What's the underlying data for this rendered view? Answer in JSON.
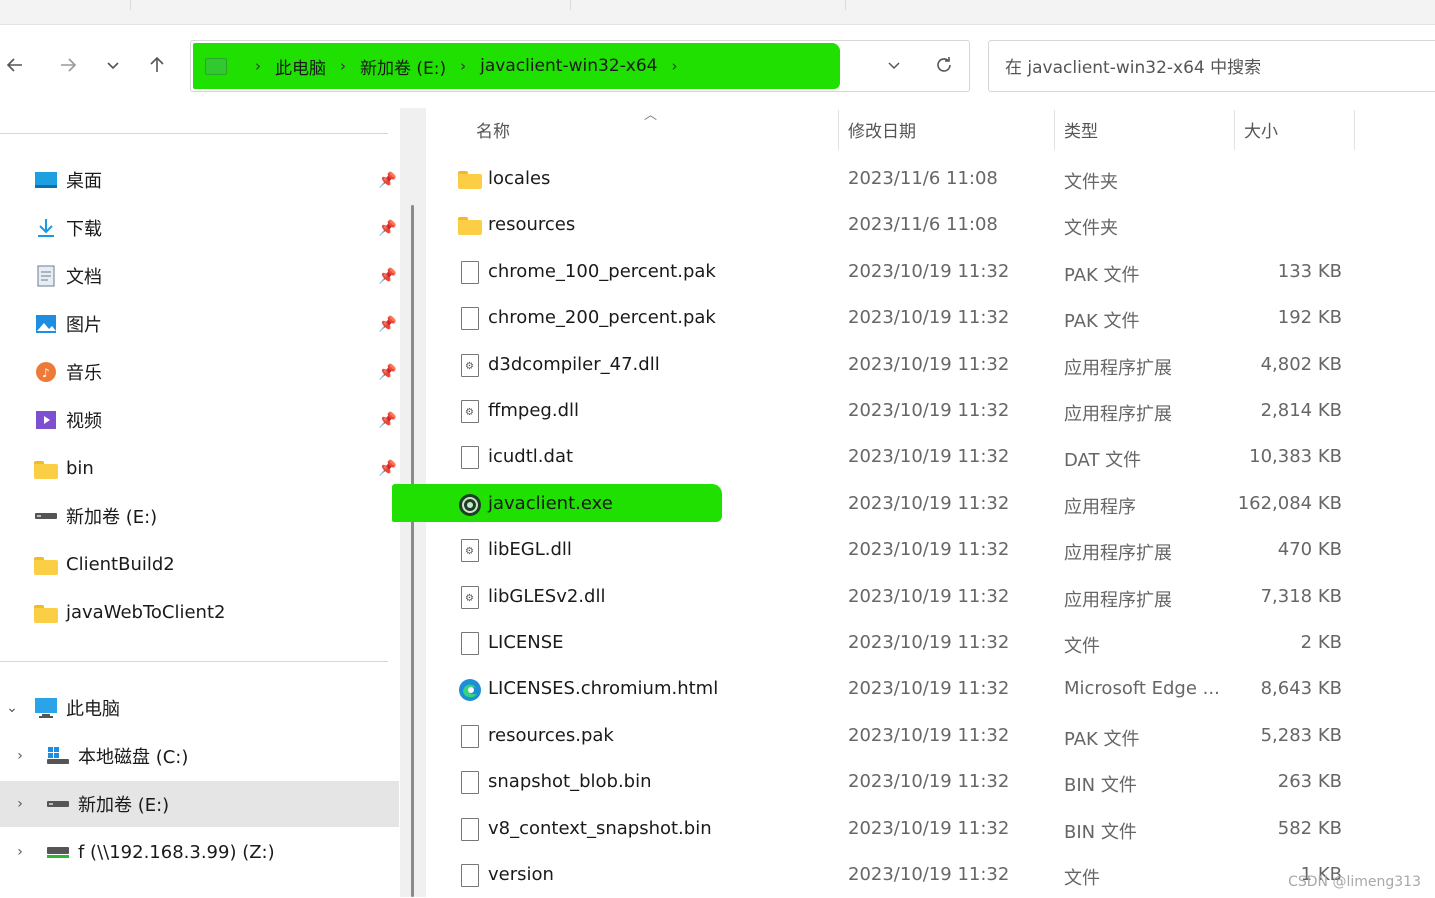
{
  "toolbar": {
    "back_icon": "arrow-left-icon",
    "forward_icon": "arrow-right-icon",
    "recent_icon": "chevron-down-icon",
    "up_icon": "arrow-up-icon"
  },
  "address": {
    "crumbs": [
      "此电脑",
      "新加卷 (E:)",
      "javaclient-win32-x64"
    ],
    "highlight_color": "#1fe000"
  },
  "search": {
    "placeholder": "在 javaclient-win32-x64 中搜索"
  },
  "navpane": {
    "quick_access": [
      {
        "label": "桌面",
        "icon": "desktop-icon"
      },
      {
        "label": "下载",
        "icon": "download-icon"
      },
      {
        "label": "文档",
        "icon": "documents-icon"
      },
      {
        "label": "图片",
        "icon": "pictures-icon"
      },
      {
        "label": "音乐",
        "icon": "music-icon"
      },
      {
        "label": "视频",
        "icon": "videos-icon"
      },
      {
        "label": "bin",
        "icon": "folder-icon"
      },
      {
        "label": "新加卷 (E:)",
        "icon": "drive-icon"
      },
      {
        "label": "ClientBuild2",
        "icon": "folder-icon"
      },
      {
        "label": "javaWebToClient2",
        "icon": "folder-icon"
      }
    ],
    "this_pc": "此电脑",
    "drives": [
      {
        "label": "本地磁盘 (C:)",
        "icon": "system-drive-icon"
      },
      {
        "label": "新加卷 (E:)",
        "icon": "drive-icon",
        "selected": true
      },
      {
        "label": "f (\\\\192.168.3.99) (Z:)",
        "icon": "network-drive-icon"
      }
    ]
  },
  "columns": {
    "name": "名称",
    "modified": "修改日期",
    "type": "类型",
    "size": "大小"
  },
  "files": [
    {
      "name": "locales",
      "date": "2023/11/6 11:08",
      "type": "文件夹",
      "size": "",
      "icon": "folder-icon"
    },
    {
      "name": "resources",
      "date": "2023/11/6 11:08",
      "type": "文件夹",
      "size": "",
      "icon": "folder-icon"
    },
    {
      "name": "chrome_100_percent.pak",
      "date": "2023/10/19 11:32",
      "type": "PAK 文件",
      "size": "133 KB",
      "icon": "file-icon"
    },
    {
      "name": "chrome_200_percent.pak",
      "date": "2023/10/19 11:32",
      "type": "PAK 文件",
      "size": "192 KB",
      "icon": "file-icon"
    },
    {
      "name": "d3dcompiler_47.dll",
      "date": "2023/10/19 11:32",
      "type": "应用程序扩展",
      "size": "4,802 KB",
      "icon": "dll-icon"
    },
    {
      "name": "ffmpeg.dll",
      "date": "2023/10/19 11:32",
      "type": "应用程序扩展",
      "size": "2,814 KB",
      "icon": "dll-icon"
    },
    {
      "name": "icudtl.dat",
      "date": "2023/10/19 11:32",
      "type": "DAT 文件",
      "size": "10,383 KB",
      "icon": "file-icon"
    },
    {
      "name": "javaclient.exe",
      "date": "2023/10/19 11:32",
      "type": "应用程序",
      "size": "162,084 KB",
      "icon": "app-icon"
    },
    {
      "name": "libEGL.dll",
      "date": "2023/10/19 11:32",
      "type": "应用程序扩展",
      "size": "470 KB",
      "icon": "dll-icon"
    },
    {
      "name": "libGLESv2.dll",
      "date": "2023/10/19 11:32",
      "type": "应用程序扩展",
      "size": "7,318 KB",
      "icon": "dll-icon"
    },
    {
      "name": "LICENSE",
      "date": "2023/10/19 11:32",
      "type": "文件",
      "size": "2 KB",
      "icon": "file-icon"
    },
    {
      "name": "LICENSES.chromium.html",
      "date": "2023/10/19 11:32",
      "type": "Microsoft Edge ...",
      "size": "8,643 KB",
      "icon": "edge-icon"
    },
    {
      "name": "resources.pak",
      "date": "2023/10/19 11:32",
      "type": "PAK 文件",
      "size": "5,283 KB",
      "icon": "file-icon"
    },
    {
      "name": "snapshot_blob.bin",
      "date": "2023/10/19 11:32",
      "type": "BIN 文件",
      "size": "263 KB",
      "icon": "file-icon"
    },
    {
      "name": "v8_context_snapshot.bin",
      "date": "2023/10/19 11:32",
      "type": "BIN 文件",
      "size": "582 KB",
      "icon": "file-icon"
    },
    {
      "name": "version",
      "date": "2023/10/19 11:32",
      "type": "文件",
      "size": "1 KB",
      "icon": "file-icon"
    }
  ],
  "watermark": "CSDN @limeng313"
}
